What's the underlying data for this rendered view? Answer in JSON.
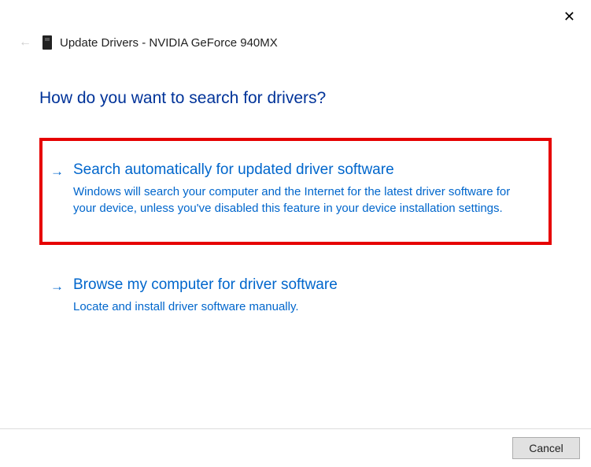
{
  "close_label": "✕",
  "back_label": "←",
  "dialog_title": "Update Drivers - NVIDIA GeForce 940MX",
  "heading": "How do you want to search for drivers?",
  "options": [
    {
      "arrow": "→",
      "title": "Search automatically for updated driver software",
      "desc": "Windows will search your computer and the Internet for the latest driver software for your device, unless you've disabled this feature in your device installation settings."
    },
    {
      "arrow": "→",
      "title": "Browse my computer for driver software",
      "desc": "Locate and install driver software manually."
    }
  ],
  "cancel_label": "Cancel"
}
